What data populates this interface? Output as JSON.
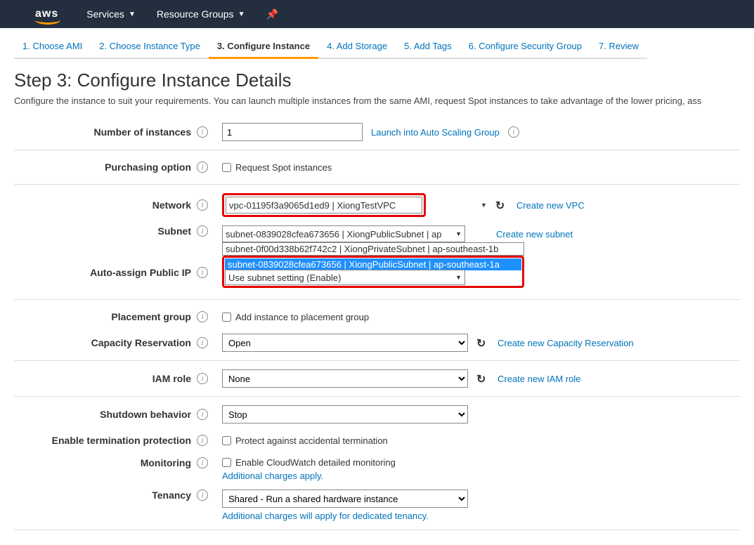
{
  "topbar": {
    "logo": "aws",
    "services": "Services",
    "resource_groups": "Resource Groups"
  },
  "wizard": {
    "steps": [
      "1. Choose AMI",
      "2. Choose Instance Type",
      "3. Configure Instance",
      "4. Add Storage",
      "5. Add Tags",
      "6. Configure Security Group",
      "7. Review"
    ],
    "active_index": 2
  },
  "heading": "Step 3: Configure Instance Details",
  "description": "Configure the instance to suit your requirements. You can launch multiple instances from the same AMI, request Spot instances to take advantage of the lower pricing, ass",
  "labels": {
    "num_instances": "Number of instances",
    "purchasing": "Purchasing option",
    "network": "Network",
    "subnet": "Subnet",
    "auto_ip": "Auto-assign Public IP",
    "placement": "Placement group",
    "capacity": "Capacity Reservation",
    "iam": "IAM role",
    "shutdown": "Shutdown behavior",
    "term_protect": "Enable termination protection",
    "monitoring": "Monitoring",
    "tenancy": "Tenancy"
  },
  "values": {
    "num_instances": "1",
    "launch_asg": "Launch into Auto Scaling Group",
    "request_spot": "Request Spot instances",
    "network": "vpc-01195f3a9065d1ed9 | XiongTestVPC",
    "create_vpc": "Create new VPC",
    "subnet_selected": "subnet-0839028cfea673656 | XiongPublicSubnet | ap",
    "subnet_opt1": "subnet-0f00d338b62f742c2 | XiongPrivateSubnet | ap-southeast-1b",
    "subnet_opt2": "subnet-0839028cfea673656 | XiongPublicSubnet | ap-southeast-1a",
    "create_subnet": "Create new subnet",
    "auto_ip": "Use subnet setting (Enable)",
    "placement_cb": "Add instance to placement group",
    "capacity": "Open",
    "create_capacity": "Create new Capacity Reservation",
    "iam": "None",
    "create_iam": "Create new IAM role",
    "shutdown": "Stop",
    "term_protect_cb": "Protect against accidental termination",
    "monitoring_cb": "Enable CloudWatch detailed monitoring",
    "monitoring_link": "Additional charges apply.",
    "tenancy": "Shared - Run a shared hardware instance",
    "tenancy_link": "Additional charges will apply for dedicated tenancy."
  }
}
